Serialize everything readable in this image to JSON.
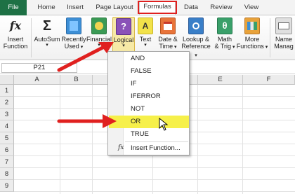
{
  "tabs": [
    {
      "label": "File"
    },
    {
      "label": "Home"
    },
    {
      "label": "Insert"
    },
    {
      "label": "Page Layout"
    },
    {
      "label": "Formulas"
    },
    {
      "label": "Data"
    },
    {
      "label": "Review"
    },
    {
      "label": "View"
    }
  ],
  "active_tab": "Formulas",
  "ribbon": {
    "insert_function": {
      "line1": "Insert",
      "line2": "Function",
      "icon": "fx-icon"
    },
    "autosum": {
      "line1": "AutoSum",
      "icon": "sigma-icon"
    },
    "recently_used": {
      "line1": "Recently",
      "line2": "Used",
      "icon": "book-icon"
    },
    "financial": {
      "line1": "Financial",
      "icon": "book-icon"
    },
    "logical": {
      "line1": "Logical",
      "icon": "question-book-icon"
    },
    "text": {
      "line1": "Text",
      "icon": "text-book-icon"
    },
    "date_time": {
      "line1": "Date &",
      "line2": "Time",
      "icon": "calendar-book-icon"
    },
    "lookup_reference": {
      "line1": "Lookup &",
      "line2": "Reference",
      "icon": "lookup-book-icon"
    },
    "math_trig": {
      "line1": "Math",
      "line2": "& Trig",
      "icon": "theta-book-icon"
    },
    "more_functions": {
      "line1": "More",
      "line2": "Functions",
      "icon": "more-books-icon"
    },
    "name_manager": {
      "line1": "Name",
      "line2": "Manag",
      "icon": "name-manager-icon"
    }
  },
  "name_box": {
    "value": "P21"
  },
  "columns": [
    "A",
    "B",
    "C",
    "D",
    "E",
    "F"
  ],
  "rows": [
    "1",
    "2",
    "3",
    "4",
    "5",
    "6",
    "7",
    "8",
    "9"
  ],
  "dropdown": {
    "items": [
      "AND",
      "FALSE",
      "IF",
      "IFERROR",
      "NOT",
      "OR",
      "TRUE"
    ],
    "highlighted": "OR",
    "insert_function": "Insert Function..."
  },
  "colors": {
    "file_tab": "#1e7145",
    "highlight": "#f6f04a",
    "annotation_red": "#e0201f"
  }
}
